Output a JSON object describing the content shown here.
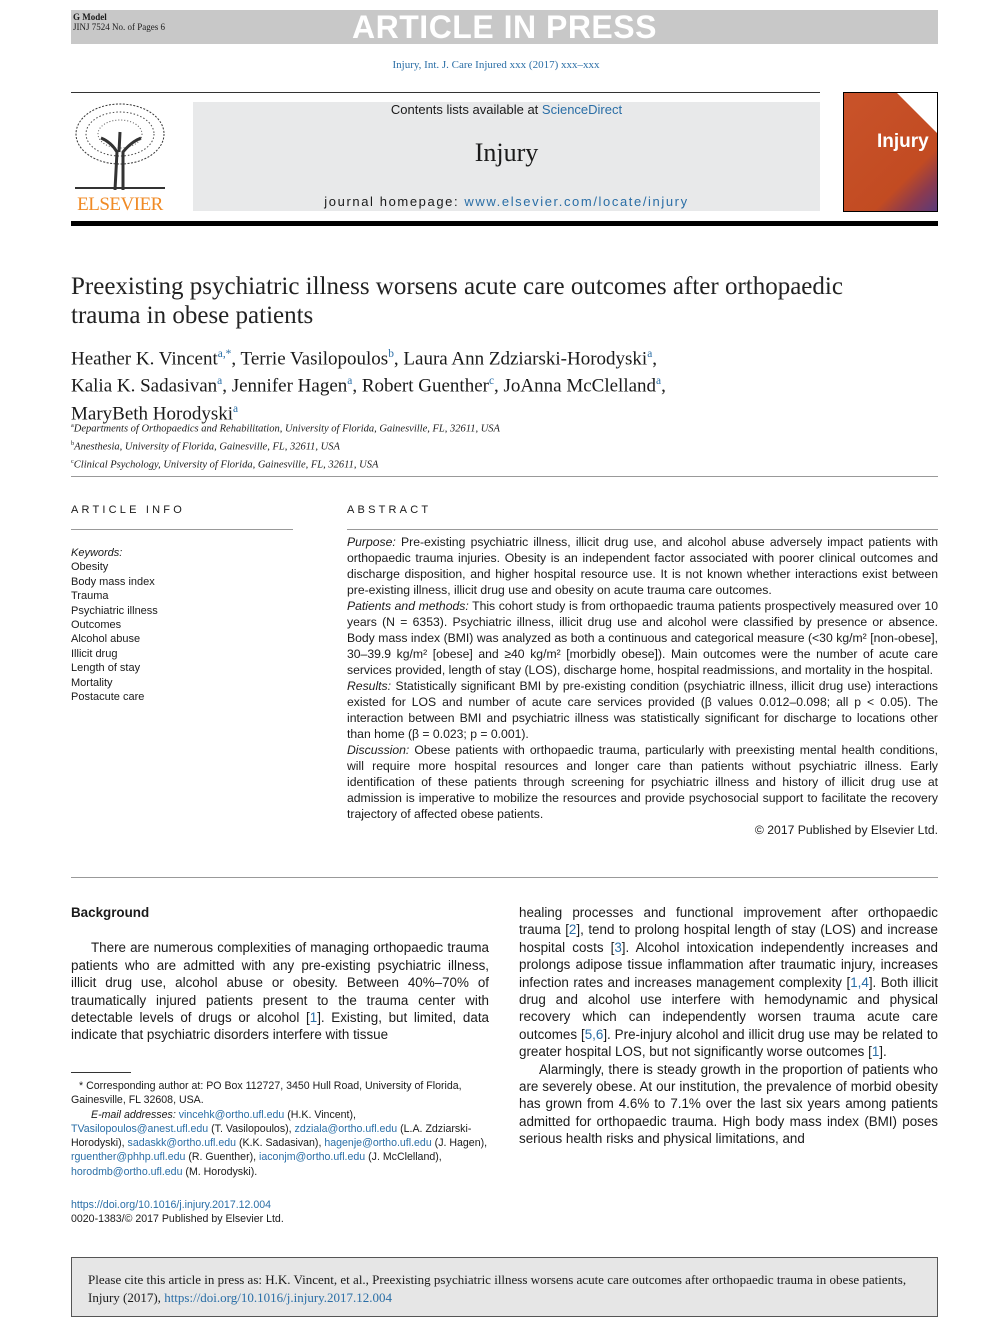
{
  "header": {
    "model": "G Model",
    "jinj": "JINJ 7524 No. of Pages 6",
    "banner": "ARTICLE IN PRESS",
    "citation": "Injury, Int. J. Care Injured xxx (2017) xxx–xxx"
  },
  "masthead": {
    "publisher": "ELSEVIER",
    "contents_prefix": "Contents lists available at ",
    "contents_link": "ScienceDirect",
    "journal": "Injury",
    "homepage_prefix": "journal homepage: ",
    "homepage_link": "www.elsevier.com/locate/injury",
    "cover_title": "Injury",
    "colors": {
      "publisher": "#f08a24",
      "link": "#2a6ea6",
      "cover": "#c9532a"
    }
  },
  "article": {
    "title": "Preexisting psychiatric illness worsens acute care outcomes after orthopaedic trauma in obese patients",
    "authors": [
      {
        "name": "Heather K. Vincent",
        "sup": "a,*",
        "sep": ", "
      },
      {
        "name": "Terrie Vasilopoulos",
        "sup": "b",
        "sep": ", "
      },
      {
        "name": "Laura Ann Zdziarski-Horodyski",
        "sup": "a",
        "sep": ",\n"
      },
      {
        "name": "Kalia K. Sadasivan",
        "sup": "a",
        "sep": ", "
      },
      {
        "name": "Jennifer Hagen",
        "sup": "a",
        "sep": ", "
      },
      {
        "name": "Robert Guenther",
        "sup": "c",
        "sep": ", "
      },
      {
        "name": "JoAnna McClelland",
        "sup": "a",
        "sep": ",\n"
      },
      {
        "name": "MaryBeth Horodyski",
        "sup": "a",
        "sep": ""
      }
    ],
    "affiliations": [
      {
        "sup": "a",
        "text": "Departments of Orthopaedics and Rehabilitation, University of Florida, Gainesville, FL, 32611, USA"
      },
      {
        "sup": "b",
        "text": "Anesthesia, University of Florida, Gainesville, FL, 32611, USA"
      },
      {
        "sup": "c",
        "text": "Clinical Psychology, University of Florida, Gainesville, FL, 32611, USA"
      }
    ]
  },
  "article_info": {
    "heading": "ARTICLE INFO",
    "keywords_label": "Keywords:",
    "keywords": [
      "Obesity",
      "Body mass index",
      "Trauma",
      "Psychiatric illness",
      "Outcomes",
      "Alcohol abuse",
      "Illicit drug",
      "Length of stay",
      "Mortality",
      "Postacute care"
    ]
  },
  "abstract": {
    "heading": "ABSTRACT",
    "sections": [
      {
        "label": "Purpose:",
        "text": " Pre-existing psychiatric illness, illicit drug use, and alcohol abuse adversely impact patients with orthopaedic trauma injuries. Obesity is an independent factor associated with poorer clinical outcomes and discharge disposition, and higher hospital resource use. It is not known whether interactions exist between pre-existing illness, illicit drug use and obesity on acute trauma care outcomes."
      },
      {
        "label": "Patients and methods:",
        "text": " This cohort study is from orthopaedic trauma patients prospectively measured over 10 years (N = 6353). Psychiatric illness, illicit drug use and alcohol were classified by presence or absence. Body mass index (BMI) was analyzed as both a continuous and categorical measure (<30 kg/m² [non-obese], 30–39.9 kg/m² [obese] and ≥40 kg/m² [morbidly obese]). Main outcomes were the number of acute care services provided, length of stay (LOS), discharge home, hospital readmissions, and mortality in the hospital."
      },
      {
        "label": "Results:",
        "text": " Statistically significant BMI by pre-existing condition (psychiatric illness, illicit drug use) interactions existed for LOS and number of acute care services provided (β values 0.012–0.098; all p < 0.05). The interaction between BMI and psychiatric illness was statistically significant for discharge to locations other than home (β = 0.023; p = 0.001)."
      },
      {
        "label": "Discussion:",
        "text": " Obese patients with orthopaedic trauma, particularly with preexisting mental health conditions, will require more hospital resources and longer care than patients without psychiatric illness. Early identification of these patients through screening for psychiatric illness and history of illicit drug use at admission is imperative to mobilize the resources and provide psychosocial support to facilitate the recovery trajectory of affected obese patients."
      }
    ],
    "copyright": "© 2017 Published by Elsevier Ltd."
  },
  "body": {
    "heading": "Background",
    "left_paragraphs": [
      [
        {
          "t": "There are numerous complexities of managing orthopaedic trauma patients who are admitted with any pre-existing psychiatric illness, illicit drug use, alcohol abuse or obesity. Between 40%–70% of traumatically injured patients present to the trauma center with detectable levels of drugs or alcohol ["
        },
        {
          "t": "1",
          "l": 1
        },
        {
          "t": "]. Existing, but limited, data indicate that psychiatric disorders interfere with tissue"
        }
      ]
    ],
    "right_paragraphs": [
      [
        {
          "t": "healing processes and functional improvement after orthopaedic trauma ["
        },
        {
          "t": "2",
          "l": 1
        },
        {
          "t": "], tend to prolong hospital length of stay (LOS) and increase hospital costs ["
        },
        {
          "t": "3",
          "l": 1
        },
        {
          "t": "]. Alcohol intoxication independently increases and prolongs adipose tissue inflammation after traumatic injury, increases infection rates and increases management complexity ["
        },
        {
          "t": "1,4",
          "l": 1
        },
        {
          "t": "]. Both illicit drug and alcohol use interfere with hemodynamic and physical recovery which can independently worsen trauma acute care outcomes ["
        },
        {
          "t": "5,6",
          "l": 1
        },
        {
          "t": "]. Pre-injury alcohol and illicit drug use may be related to greater hospital LOS, but not significantly worse outcomes ["
        },
        {
          "t": "1",
          "l": 1
        },
        {
          "t": "]."
        }
      ],
      [
        {
          "t": "Alarmingly, there is steady growth in the proportion of patients who are severely obese. At our institution, the prevalence of morbid obesity has grown from 4.6% to 7.1% over the last six years among patients admitted for orthopaedic trauma. High body mass index (BMI) poses serious health risks and physical limitations, and"
        }
      ]
    ]
  },
  "footnotes": {
    "corresponding": [
      {
        "t": "* Corresponding author at: PO Box 112727, 3450 Hull Road, University of Florida, Gainesville, FL 32608, USA."
      }
    ],
    "emails": [
      {
        "t": "E-mail addresses: ",
        "i": 1
      },
      {
        "t": "vincehk@ortho.ufl.edu",
        "l": 1
      },
      {
        "t": " (H.K. Vincent), "
      },
      {
        "t": "TVasilopoulos@anest.ufl.edu",
        "l": 1
      },
      {
        "t": " (T. Vasilopoulos), "
      },
      {
        "t": "zdziala@ortho.ufl.edu",
        "l": 1
      },
      {
        "t": " (L.A. Zdziarski-Horodyski), "
      },
      {
        "t": "sadaskk@ortho.ufl.edu",
        "l": 1
      },
      {
        "t": " (K.K. Sadasivan), "
      },
      {
        "t": "hagenje@ortho.ufl.edu",
        "l": 1
      },
      {
        "t": " (J. Hagen), "
      },
      {
        "t": "rguenther@phhp.ufl.edu",
        "l": 1
      },
      {
        "t": " (R. Guenther), "
      },
      {
        "t": "iaconjm@ortho.ufl.edu",
        "l": 1
      },
      {
        "t": " (J. McClelland), "
      },
      {
        "t": "horodmb@ortho.ufl.edu",
        "l": 1
      },
      {
        "t": " (M. Horodyski)."
      }
    ],
    "doi": "https://doi.org/10.1016/j.injury.2017.12.004",
    "issn": "0020-1383/© 2017 Published by Elsevier Ltd."
  },
  "cite_box": [
    {
      "t": "Please cite this article in press as: H.K. Vincent, et al., Preexisting psychiatric illness worsens acute care outcomes after orthopaedic trauma in obese patients, Injury (2017), "
    },
    {
      "t": "https://doi.org/10.1016/j.injury.2017.12.004",
      "l": 1
    }
  ]
}
